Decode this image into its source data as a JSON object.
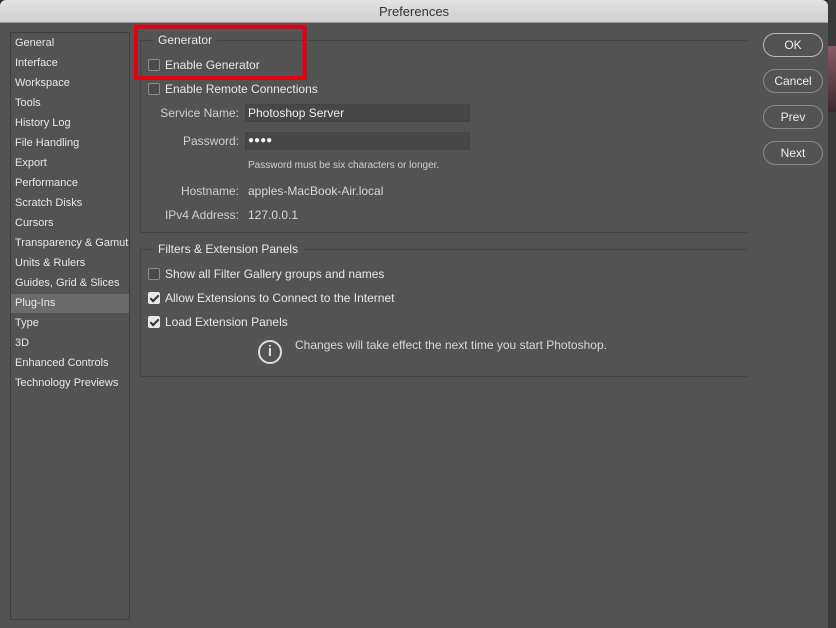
{
  "window": {
    "title": "Preferences"
  },
  "sidebar": {
    "selected": "Plug-Ins",
    "items": [
      {
        "label": "General"
      },
      {
        "label": "Interface"
      },
      {
        "label": "Workspace"
      },
      {
        "label": "Tools"
      },
      {
        "label": "History Log"
      },
      {
        "label": "File Handling"
      },
      {
        "label": "Export"
      },
      {
        "label": "Performance"
      },
      {
        "label": "Scratch Disks"
      },
      {
        "label": "Cursors"
      },
      {
        "label": "Transparency & Gamut"
      },
      {
        "label": "Units & Rulers"
      },
      {
        "label": "Guides, Grid & Slices"
      },
      {
        "label": "Plug-Ins"
      },
      {
        "label": "Type"
      },
      {
        "label": "3D"
      },
      {
        "label": "Enhanced Controls"
      },
      {
        "label": "Technology Previews"
      }
    ]
  },
  "generator": {
    "title": "Generator",
    "enable_generator": {
      "label": "Enable Generator",
      "checked": false
    },
    "enable_remote": {
      "label": "Enable Remote Connections",
      "checked": false
    },
    "service_name": {
      "label": "Service Name:",
      "value": "Photoshop Server"
    },
    "password": {
      "label": "Password:",
      "value": "●●●●",
      "hint": "Password must be six characters or longer."
    },
    "hostname": {
      "label": "Hostname:",
      "value": "apples-MacBook-Air.local"
    },
    "ipv4": {
      "label": "IPv4 Address:",
      "value": "127.0.0.1"
    }
  },
  "filters": {
    "title": "Filters & Extension Panels",
    "show_filter_gallery": {
      "label": "Show all Filter Gallery groups and names",
      "checked": false
    },
    "allow_extensions": {
      "label": "Allow Extensions to Connect to the Internet",
      "checked": true
    },
    "load_panels": {
      "label": "Load Extension Panels",
      "checked": true
    },
    "info": {
      "icon": "info-icon",
      "text": "Changes will take effect the next time you start Photoshop."
    }
  },
  "buttons": {
    "ok": "OK",
    "cancel": "Cancel",
    "prev": "Prev",
    "next": "Next"
  },
  "colors": {
    "highlight": "#e4000f",
    "dialog_bg": "#535353",
    "selected_item": "#6b6b6b"
  }
}
